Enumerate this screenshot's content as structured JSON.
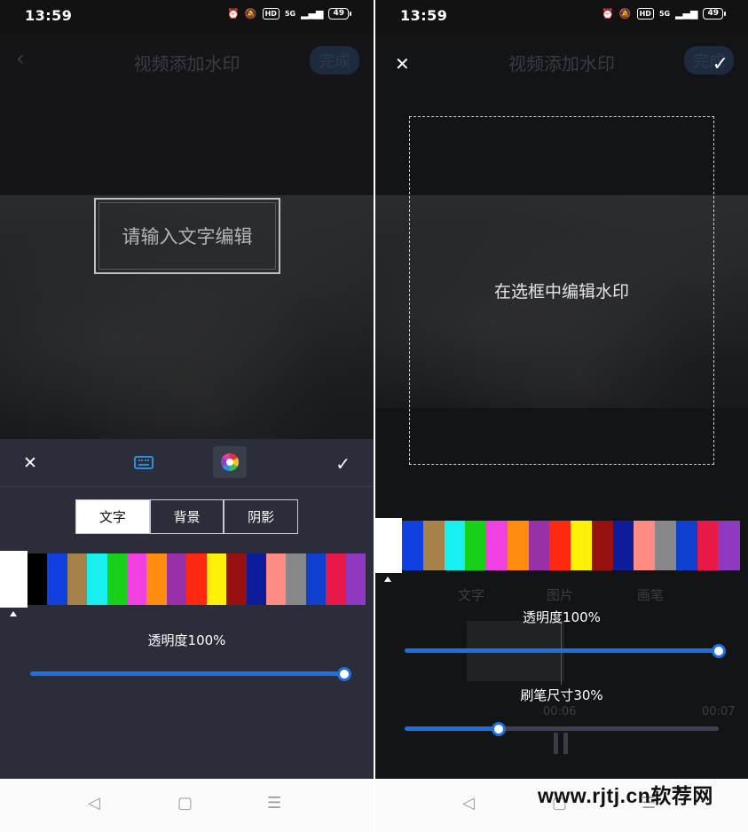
{
  "left": {
    "status": {
      "time": "13:59",
      "battery": "49",
      "network": "5G"
    },
    "header": {
      "title": "视频添加水印",
      "done_label": "完成"
    },
    "text_box": {
      "placeholder": "请输入文字编辑"
    },
    "tabs": [
      {
        "label": "文字",
        "active": true
      },
      {
        "label": "背景",
        "active": false
      },
      {
        "label": "阴影",
        "active": false
      }
    ],
    "selected_color": "#ffffff",
    "palette": [
      "#000000",
      "#1040e0",
      "#a8804a",
      "#18f0f0",
      "#18d018",
      "#f040e0",
      "#ff8c10",
      "#9830a8",
      "#ff2810",
      "#fff008",
      "#981010",
      "#0c1c9c",
      "#ff8c84",
      "#888888",
      "#1040d0",
      "#e81848",
      "#9038c0"
    ],
    "opacity": {
      "label": "透明度100%",
      "value": 1.0
    },
    "icons": [
      "close-icon",
      "keyboard-icon",
      "color-wheel-icon",
      "check-icon"
    ]
  },
  "right": {
    "status": {
      "time": "13:59",
      "battery": "49",
      "network": "5G"
    },
    "header": {
      "title": "视频添加水印",
      "done_label": "完成"
    },
    "frame_hint": "在选框中编辑水印",
    "selected_color": "#ffffff",
    "palette": [
      "#1040e0",
      "#a8804a",
      "#18f0f0",
      "#18d018",
      "#f040e0",
      "#ff8c10",
      "#9830a8",
      "#ff2810",
      "#fff008",
      "#981010",
      "#0c1c9c",
      "#ff8c84",
      "#888888",
      "#1040d0",
      "#e81848",
      "#9038c0"
    ],
    "opacity": {
      "label": "透明度100%",
      "value": 1.0
    },
    "brush_size": {
      "label": "刷笔尺寸30%",
      "value": 0.3
    },
    "behind_tabs": [
      "文字",
      "图片",
      "画笔"
    ],
    "behind_times": {
      "current": "00:06",
      "total": "00:07"
    }
  },
  "watermark": "www.rjtj.cn软荐网"
}
